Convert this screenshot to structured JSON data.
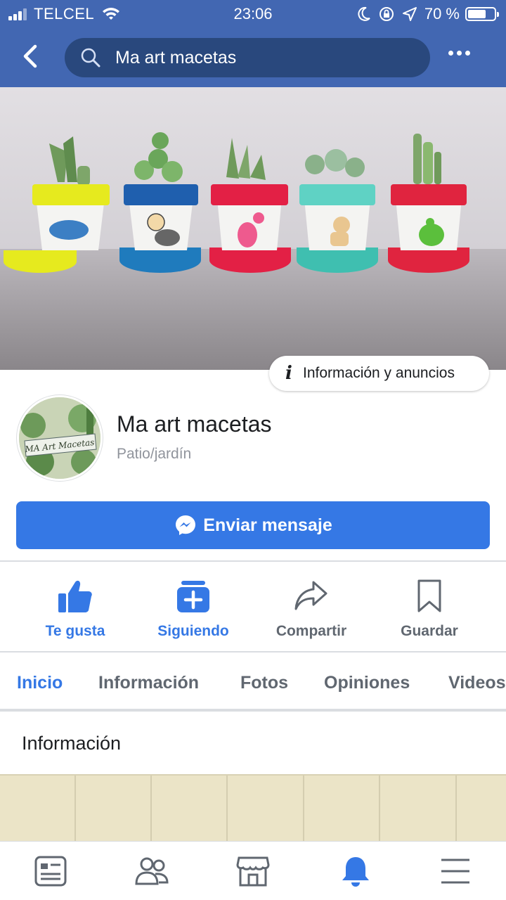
{
  "status_bar": {
    "carrier": "TELCEL",
    "time": "23:06",
    "battery": "70 %",
    "battery_level": 0.7
  },
  "search": {
    "query": "Ma art macetas"
  },
  "cover": {
    "info_button": "Información y anuncios"
  },
  "profile": {
    "name": "Ma art macetas",
    "category": "Patio/jardín",
    "avatar_text": "MA Art Macetas"
  },
  "message_button": "Enviar mensaje",
  "actions": [
    {
      "label": "Te gusta",
      "icon": "thumbs-up-icon"
    },
    {
      "label": "Siguiendo",
      "icon": "following-icon"
    },
    {
      "label": "Compartir",
      "icon": "share-icon"
    },
    {
      "label": "Guardar",
      "icon": "bookmark-icon"
    }
  ],
  "tabs": [
    "Inicio",
    "Información",
    "Fotos",
    "Opiniones",
    "Videos"
  ],
  "active_tab": "Inicio",
  "section": {
    "title": "Información"
  },
  "bottom_nav": [
    "news-feed-icon",
    "friends-icon",
    "marketplace-icon",
    "notifications-icon",
    "menu-icon"
  ],
  "colors": {
    "header": "#4267b2",
    "accent": "#3578e5",
    "muted": "#606770"
  }
}
